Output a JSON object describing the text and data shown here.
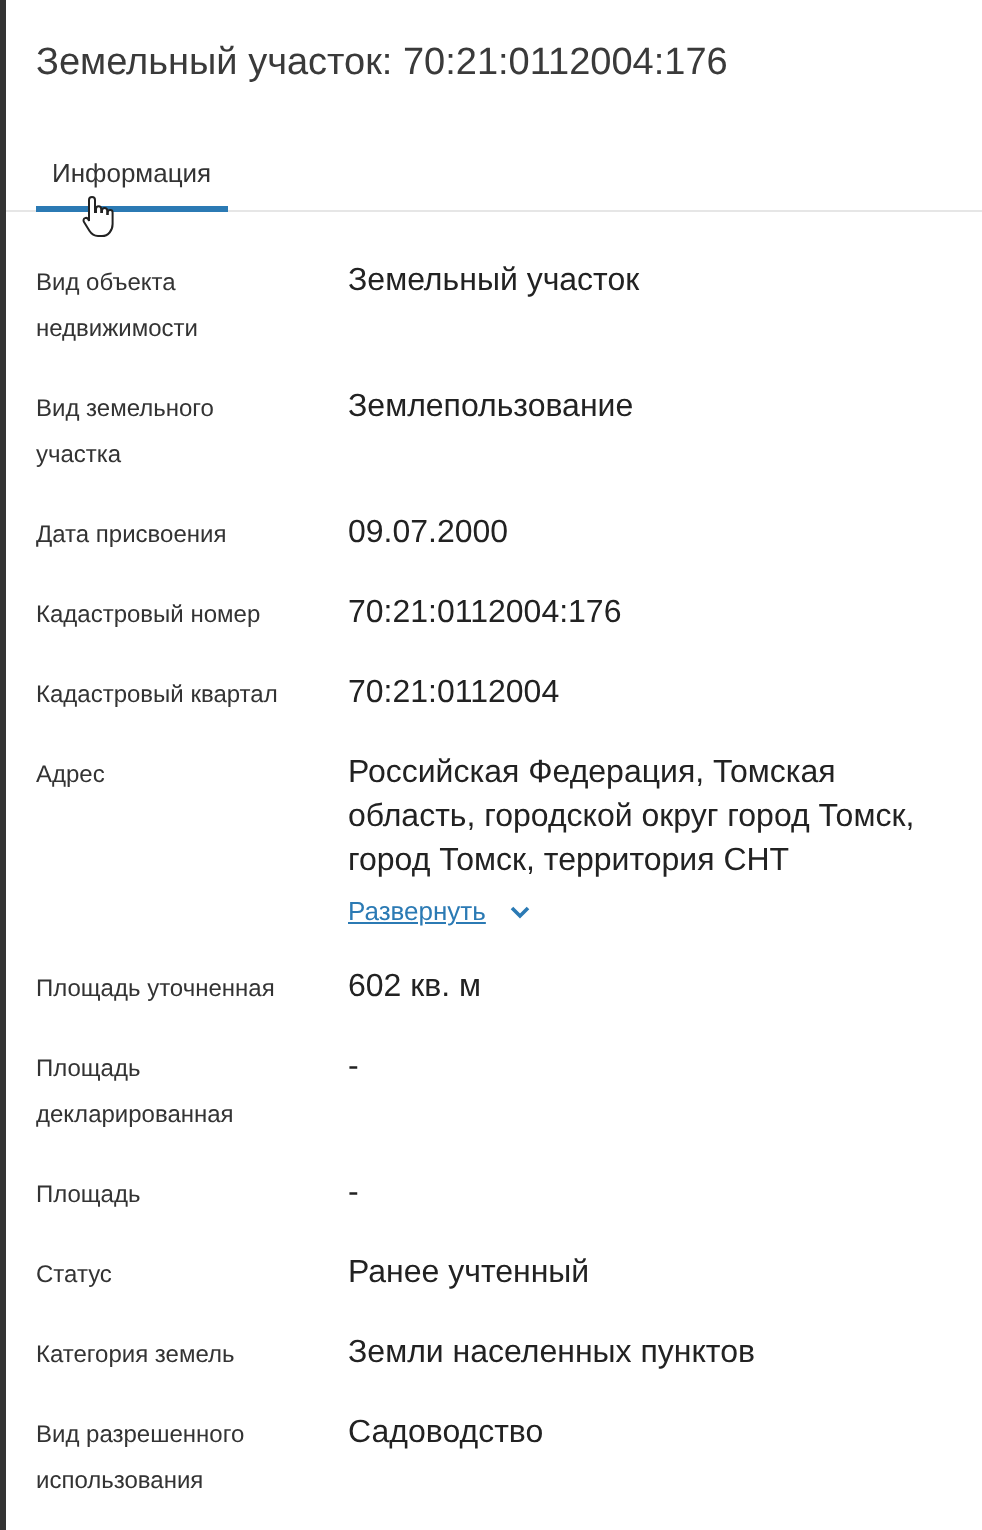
{
  "title": "Земельный участок: 70:21:0112004:176",
  "tabs": [
    {
      "label": "Информация",
      "selected": true
    }
  ],
  "fields": [
    {
      "label": "Вид объекта недвижимости",
      "value": "Земельный участок"
    },
    {
      "label": "Вид земельного участка",
      "value": "Землепользование"
    },
    {
      "label": "Дата присвоения",
      "value": "09.07.2000"
    },
    {
      "label": "Кадастровый номер",
      "value": "70:21:0112004:176"
    },
    {
      "label": "Кадастровый квартал",
      "value": "70:21:0112004"
    },
    {
      "label": "Адрес",
      "value": "Российская Федерация, Томская область, городской округ город Томск, город Томск, территория СНТ",
      "expand_link": "Развернуть"
    },
    {
      "label": "Площадь уточненная",
      "value": "602 кв. м"
    },
    {
      "label": "Площадь декларированная",
      "value": "-"
    },
    {
      "label": "Площадь",
      "value": "-"
    },
    {
      "label": "Статус",
      "value": "Ранее учтенный"
    },
    {
      "label": "Категория земель",
      "value": "Земли населенных пунктов"
    },
    {
      "label": "Вид разрешенного использования",
      "value": "Садоводство"
    }
  ]
}
